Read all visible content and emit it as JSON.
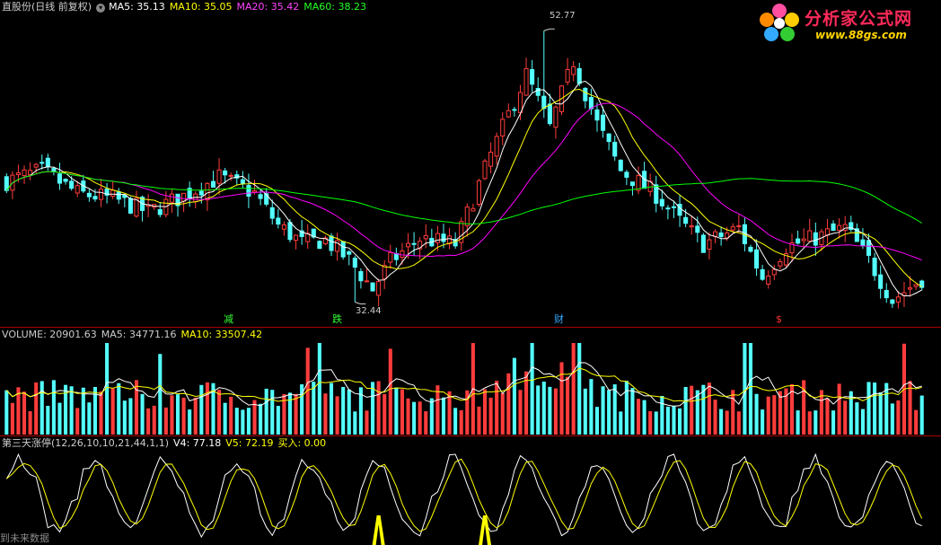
{
  "price_panel": {
    "title": "直股份(日线 前复权)",
    "ma5": "MA5: 35.13",
    "ma10": "MA10: 35.05",
    "ma20": "MA20: 35.42",
    "ma60": "MA60: 38.23",
    "high_label": "52.77",
    "low_label": "32.44",
    "events": [
      "减",
      "跌",
      "财",
      "$"
    ]
  },
  "volume_panel": {
    "volume": "VOLUME: 20901.63",
    "ma5": "MA5: 34771.16",
    "ma10": "MA10: 33507.42"
  },
  "indicator_panel": {
    "name": "第三天涨停(12,26,10,10,21,44,1,1)",
    "v4": "V4: 77.18",
    "v5": "V5: 72.19",
    "buy": "买入: 0.00"
  },
  "logo": {
    "name": "分析家公式网",
    "url": "www.88gs.com"
  },
  "bottom_note": "到未来数据",
  "colors": {
    "up": "#ff3c3c",
    "down": "#54ffff",
    "ma5": "#ffffff",
    "ma10": "#ffff00",
    "ma20": "#ff00ff",
    "ma60": "#00ff00",
    "divider": "#aa0000",
    "title_text": "#cccccc",
    "buy_signal": "#ffff00"
  },
  "chart_data": {
    "type": "candlestick",
    "bars": 156,
    "price_anchors": [
      [
        0,
        41.5
      ],
      [
        6,
        42.3
      ],
      [
        12,
        40.6
      ],
      [
        18,
        40.2
      ],
      [
        24,
        39.2
      ],
      [
        30,
        40.4
      ],
      [
        36,
        41.8
      ],
      [
        42,
        40.6
      ],
      [
        46,
        38.2
      ],
      [
        50,
        36.9
      ],
      [
        54,
        37.1
      ],
      [
        58,
        35.6
      ],
      [
        62,
        33.4
      ],
      [
        65,
        35.5
      ],
      [
        70,
        37.2
      ],
      [
        76,
        36.8
      ],
      [
        82,
        43.5
      ],
      [
        88,
        49.5
      ],
      [
        92,
        45.5
      ],
      [
        96,
        50.5
      ],
      [
        100,
        45.8
      ],
      [
        104,
        42.3
      ],
      [
        110,
        40.5
      ],
      [
        114,
        38.5
      ],
      [
        118,
        36.8
      ],
      [
        124,
        38.0
      ],
      [
        128,
        34.3
      ],
      [
        132,
        36.6
      ],
      [
        138,
        37.4
      ],
      [
        142,
        38.0
      ],
      [
        146,
        35.6
      ],
      [
        150,
        32.6
      ],
      [
        155,
        34.2
      ]
    ],
    "high": {
      "value": 52.77,
      "bar": 91
    },
    "low": {
      "value": 32.44,
      "bar": 59
    },
    "y_range": [
      31.8,
      54.0
    ],
    "indicator": {
      "series": [
        "V4",
        "V5"
      ],
      "buy_signals": [
        63,
        81
      ],
      "y_range": [
        0,
        100
      ]
    }
  }
}
